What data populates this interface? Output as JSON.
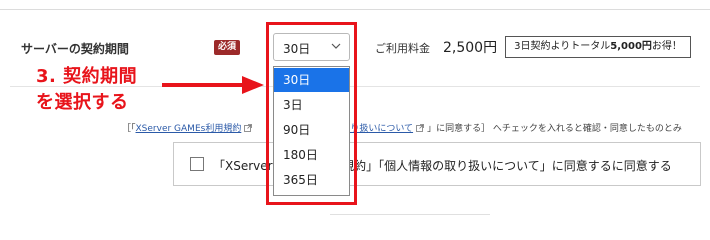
{
  "contract": {
    "period_label": "サーバーの契約期間",
    "required_badge": "必須",
    "selected_period": "30日",
    "period_options": [
      "30日",
      "3日",
      "90日",
      "180日",
      "365日"
    ],
    "fee_label": "ご利用料金",
    "fee_value": "2,500円",
    "promo_pre": "3日契約よりトータル",
    "promo_amount": "5,000円",
    "promo_post": "お得！"
  },
  "annotation": {
    "step_line1": "3. 契約期間",
    "step_line2": "を選択する",
    "accent_color": "#e8141b"
  },
  "agreement": {
    "note_open": "［「",
    "terms_link": "XServer GAMEs利用規約",
    "note_hidden_link": "取り扱いについて",
    "note_rest": "」に同意する］ へチェックを入れると確認・同意したものとみ",
    "checkbox_label": "「XServer GAMEs利用規約」「個人情報の取り扱いについて」に同意するに同意する"
  },
  "colors": {
    "selected_option_bg": "#1a73e8",
    "badge_bg": "#9c2a2a"
  },
  "icons": {
    "select_arrow": "chevron-down-icon",
    "external_link": "external-link-icon",
    "pointer_arrow": "arrow-right-icon"
  }
}
